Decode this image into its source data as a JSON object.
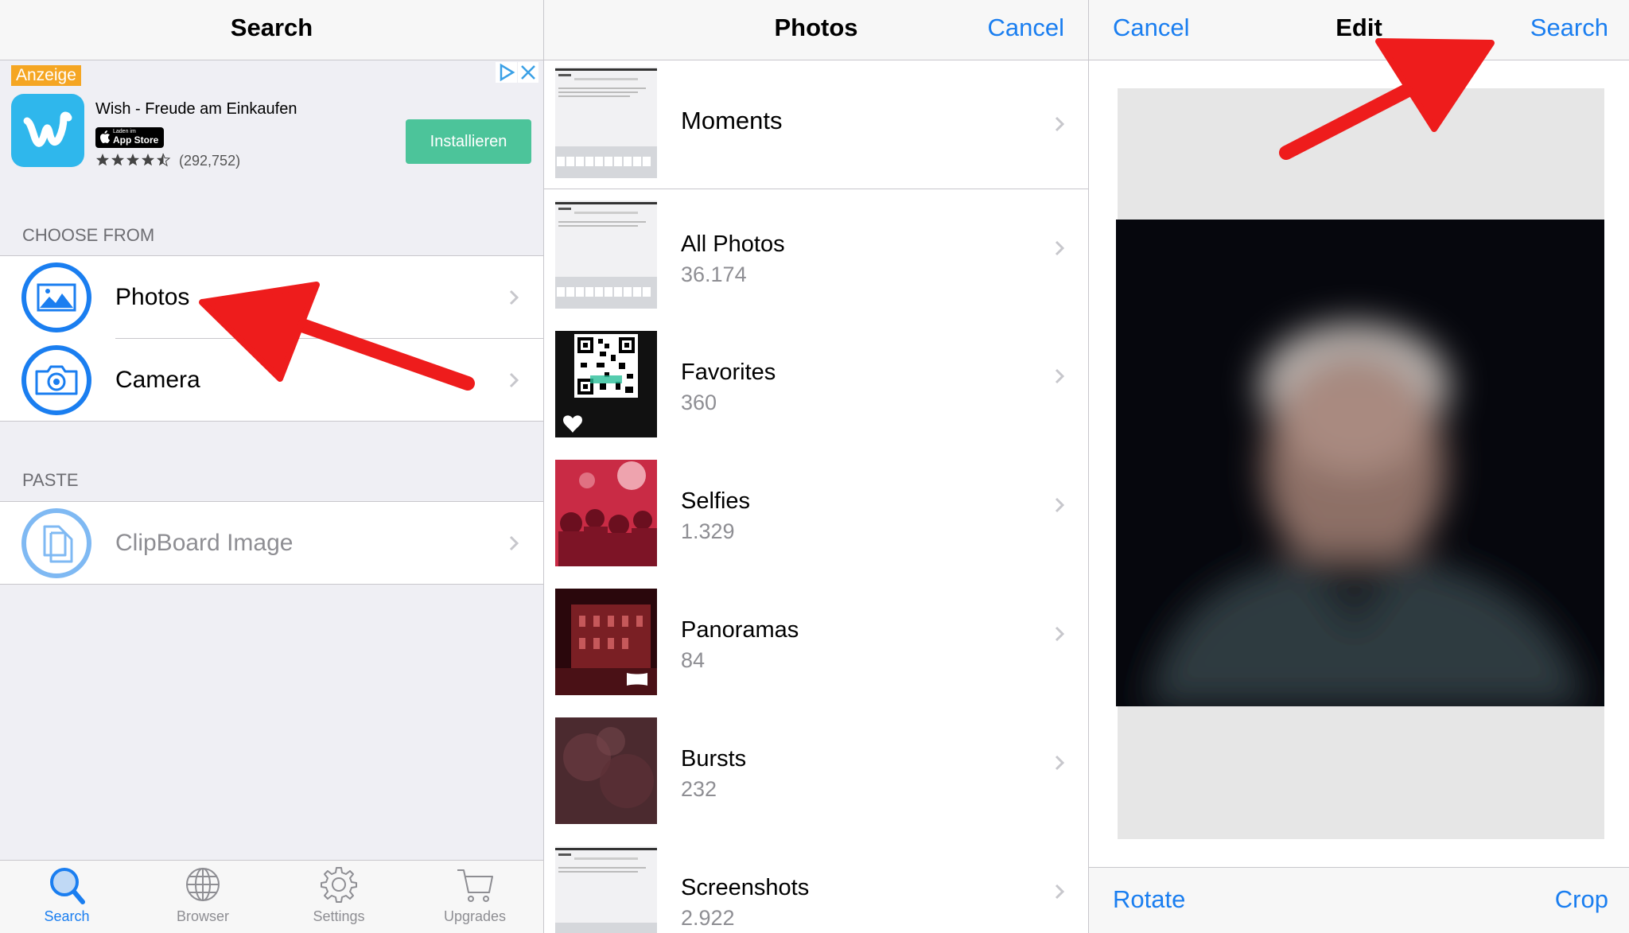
{
  "colors": {
    "accent": "#1a7ef0",
    "arrow": "#ee1c1c",
    "install_button": "#4cc49a",
    "ad_tag": "#f5a623"
  },
  "panel_search": {
    "title": "Search",
    "ad": {
      "tag": "Anzeige",
      "app_name": "Wish - Freude am Einkaufen",
      "store_badge_small": "Laden im",
      "store_badge_large": "App Store",
      "rating_count": "(292,752)",
      "stars": 4.5,
      "install_label": "Installieren"
    },
    "choose_header": "CHOOSE FROM",
    "choose_items": [
      {
        "label": "Photos",
        "icon": "photo-icon"
      },
      {
        "label": "Camera",
        "icon": "camera-icon"
      }
    ],
    "paste_header": "PASTE",
    "paste_items": [
      {
        "label": "ClipBoard Image",
        "icon": "clipboard-icon"
      }
    ],
    "tabs": [
      {
        "label": "Search",
        "icon": "search-icon",
        "active": true
      },
      {
        "label": "Browser",
        "icon": "globe-icon",
        "active": false
      },
      {
        "label": "Settings",
        "icon": "gear-icon",
        "active": false
      },
      {
        "label": "Upgrades",
        "icon": "cart-icon",
        "active": false
      }
    ]
  },
  "panel_photos": {
    "title": "Photos",
    "cancel_label": "Cancel",
    "albums": [
      {
        "title": "Moments",
        "count": ""
      },
      {
        "title": "All Photos",
        "count": "36.174"
      },
      {
        "title": "Favorites",
        "count": "360"
      },
      {
        "title": "Selfies",
        "count": "1.329"
      },
      {
        "title": "Panoramas",
        "count": "84"
      },
      {
        "title": "Bursts",
        "count": "232"
      },
      {
        "title": "Screenshots",
        "count": "2.922"
      }
    ]
  },
  "panel_edit": {
    "title": "Edit",
    "cancel_label": "Cancel",
    "search_label": "Search",
    "rotate_label": "Rotate",
    "crop_label": "Crop"
  }
}
